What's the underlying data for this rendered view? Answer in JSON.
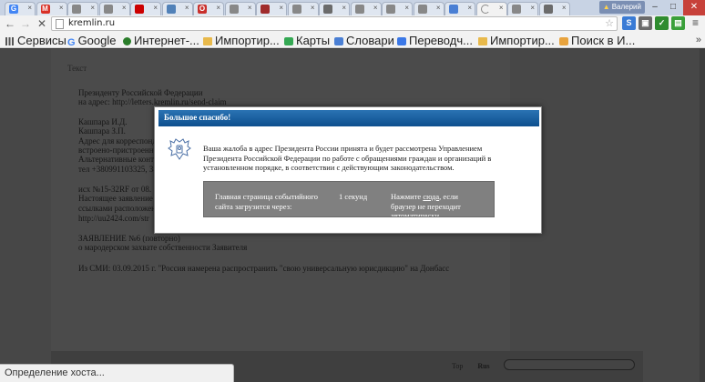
{
  "browser": {
    "tabs": [
      {
        "icon": "google-icon",
        "glyph": "G",
        "color": "#4285f4"
      },
      {
        "icon": "gmail-icon",
        "glyph": "M",
        "color": "#d93025"
      },
      {
        "icon": "generic-page-icon",
        "glyph": "",
        "color": "#888888"
      },
      {
        "icon": "generic-page-icon",
        "glyph": "",
        "color": "#888888"
      },
      {
        "icon": "youtube-icon",
        "glyph": "",
        "color": "#cc0000"
      },
      {
        "icon": "vk-icon",
        "glyph": "",
        "color": "#5181b8"
      },
      {
        "icon": "opera-icon",
        "glyph": "O",
        "color": "#c9302c"
      },
      {
        "icon": "generic-page-icon",
        "glyph": "",
        "color": "#888888"
      },
      {
        "icon": "uzb-icon",
        "glyph": "",
        "color": "#a02b2b"
      },
      {
        "icon": "generic-page-icon",
        "glyph": "",
        "color": "#888888"
      },
      {
        "icon": "pb-icon",
        "glyph": "",
        "color": "#6b6b6b"
      },
      {
        "icon": "generic-page-icon",
        "glyph": "",
        "color": "#888888"
      },
      {
        "icon": "generic-page-icon",
        "glyph": "",
        "color": "#888888"
      },
      {
        "icon": "generic-page-icon",
        "glyph": "",
        "color": "#888888"
      },
      {
        "icon": "translate-icon",
        "glyph": "",
        "color": "#4a7fd4"
      },
      {
        "icon": "loading-icon",
        "glyph": "",
        "color": "#888888"
      },
      {
        "icon": "generic-page-icon",
        "glyph": "",
        "color": "#888888"
      },
      {
        "icon": "pb-icon",
        "glyph": "",
        "color": "#6b6b6b"
      }
    ],
    "user_badge": "Валерий",
    "url": "kremlin.ru"
  },
  "bookmarks": [
    {
      "label": "Сервисы",
      "icon": "apps-icon",
      "ic": "ic-apps"
    },
    {
      "label": "Google",
      "icon": "google-icon",
      "ic": "ic-g"
    },
    {
      "label": "Интернет-...",
      "icon": "globe-icon",
      "ic": "ic-dot"
    },
    {
      "label": "Импортир...",
      "icon": "folder-icon",
      "ic": "ic-folder"
    },
    {
      "label": "Карты",
      "icon": "maps-icon",
      "ic": "ic-maps"
    },
    {
      "label": "Словари",
      "icon": "dictionary-icon",
      "ic": "ic-dict"
    },
    {
      "label": "Переводч...",
      "icon": "translate-icon",
      "ic": "ic-tr"
    },
    {
      "label": "Импортир...",
      "icon": "folder-icon",
      "ic": "ic-folder"
    },
    {
      "label": "Поиск в И...",
      "icon": "search-icon",
      "ic": "ic-search"
    }
  ],
  "page": {
    "heading": "Текст",
    "lines": [
      "Президенту Российской Федерации",
      "на адрес: http://letters.kremlin.ru/send-claim",
      "Кашпара И.Д.",
      "Кашпара З.П.",
      "Адрес для корреспонденции",
      "встроено-пристроенно",
      "Альтернативные конта",
      "тел +380991103325, 38",
      "исх №15-32RF от 08.",
      "Настоящее заявление",
      "ссылками расположена",
      "http://uu2424.com/str",
      "ЗАЯВЛЕНИЕ №6 (повторно)",
      "о мародерском захвате собственности Заявителя",
      "Из СМИ: 03.09.2015 г. \"Россия намерена распространить \"свою универсальную юрисдикцию\" на Донбасс"
    ],
    "footer_links": [
      "Top",
      "Rus"
    ]
  },
  "modal": {
    "title": "Большое спасибо!",
    "message": "Ваша жалоба в адрес Президента России принята и будет рассмотрена Управлением Президента Российской Федерации по работе с обращениями граждан и организаций в установленном порядке, в соответствии с действующим законодательством.",
    "redirect_label": "Главная страница событийного сайта загрузится через:",
    "countdown": "1 секунд",
    "click_prefix": "Нажмите",
    "click_link": "сюда",
    "click_suffix": ", если браузер не переходит автоматически."
  },
  "status_text": "Определение хоста..."
}
